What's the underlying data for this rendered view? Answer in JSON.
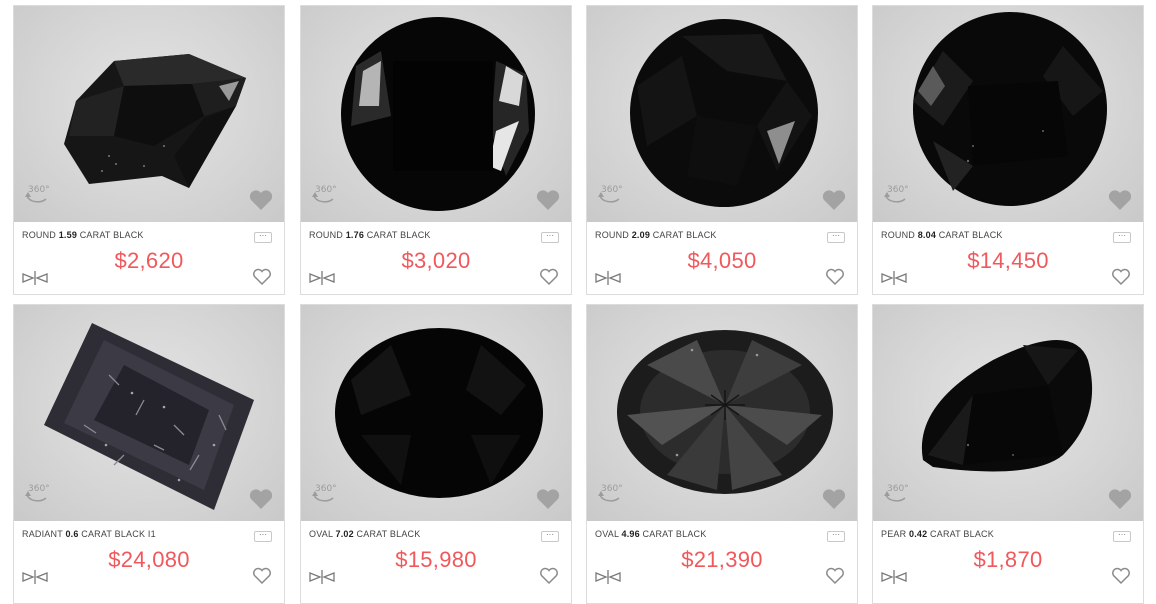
{
  "accent_price_color": "#f0585c",
  "products": [
    {
      "shape": "ROUND",
      "carat": "1.59",
      "desc": "CARAT BLACK",
      "price": "$2,620",
      "view_badge": "360°"
    },
    {
      "shape": "ROUND",
      "carat": "1.76",
      "desc": "CARAT BLACK",
      "price": "$3,020",
      "view_badge": "360°"
    },
    {
      "shape": "ROUND",
      "carat": "2.09",
      "desc": "CARAT BLACK",
      "price": "$4,050",
      "view_badge": "360°"
    },
    {
      "shape": "ROUND",
      "carat": "8.04",
      "desc": "CARAT BLACK",
      "price": "$14,450",
      "view_badge": "360°"
    },
    {
      "shape": "RADIANT",
      "carat": "0.6",
      "desc": "CARAT BLACK I1",
      "price": "$24,080",
      "view_badge": "360°"
    },
    {
      "shape": "OVAL",
      "carat": "7.02",
      "desc": "CARAT BLACK",
      "price": "$15,980",
      "view_badge": "360°"
    },
    {
      "shape": "OVAL",
      "carat": "4.96",
      "desc": "CARAT BLACK",
      "price": "$21,390",
      "view_badge": "360°"
    },
    {
      "shape": "PEAR",
      "carat": "0.42",
      "desc": "CARAT BLACK",
      "price": "$1,870",
      "view_badge": "360°"
    }
  ],
  "icons": {
    "more": "more-options-icon",
    "compare": "compare-icon",
    "favorite": "heart-icon",
    "view360": "rotate-360-icon"
  }
}
